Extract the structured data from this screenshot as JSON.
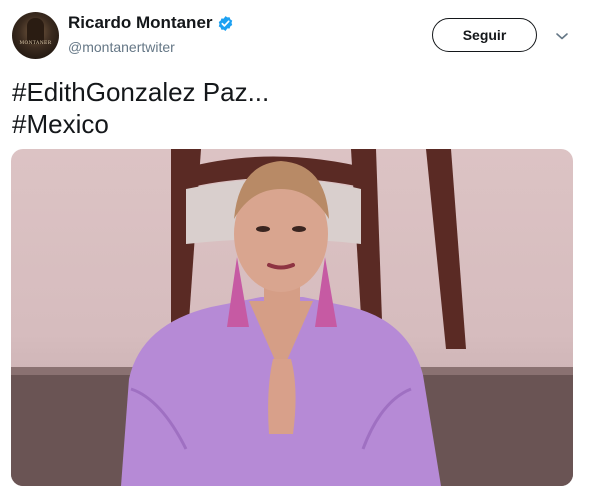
{
  "user": {
    "display_name": "Ricardo Montaner",
    "handle": "@montanertwiter",
    "avatar_wordmark": "MONTANER",
    "verified": true
  },
  "actions": {
    "follow_label": "Seguir"
  },
  "tweet": {
    "lines": [
      "#EdithGonzalez Paz...",
      "#Mexico"
    ]
  },
  "colors": {
    "text_primary": "#14171a",
    "text_secondary": "#657786",
    "verified_blue": "#1da1f2",
    "dress_lilac": "#b68ad6"
  },
  "icons": {
    "verified": "verified-badge-icon",
    "caret": "chevron-down-icon"
  }
}
